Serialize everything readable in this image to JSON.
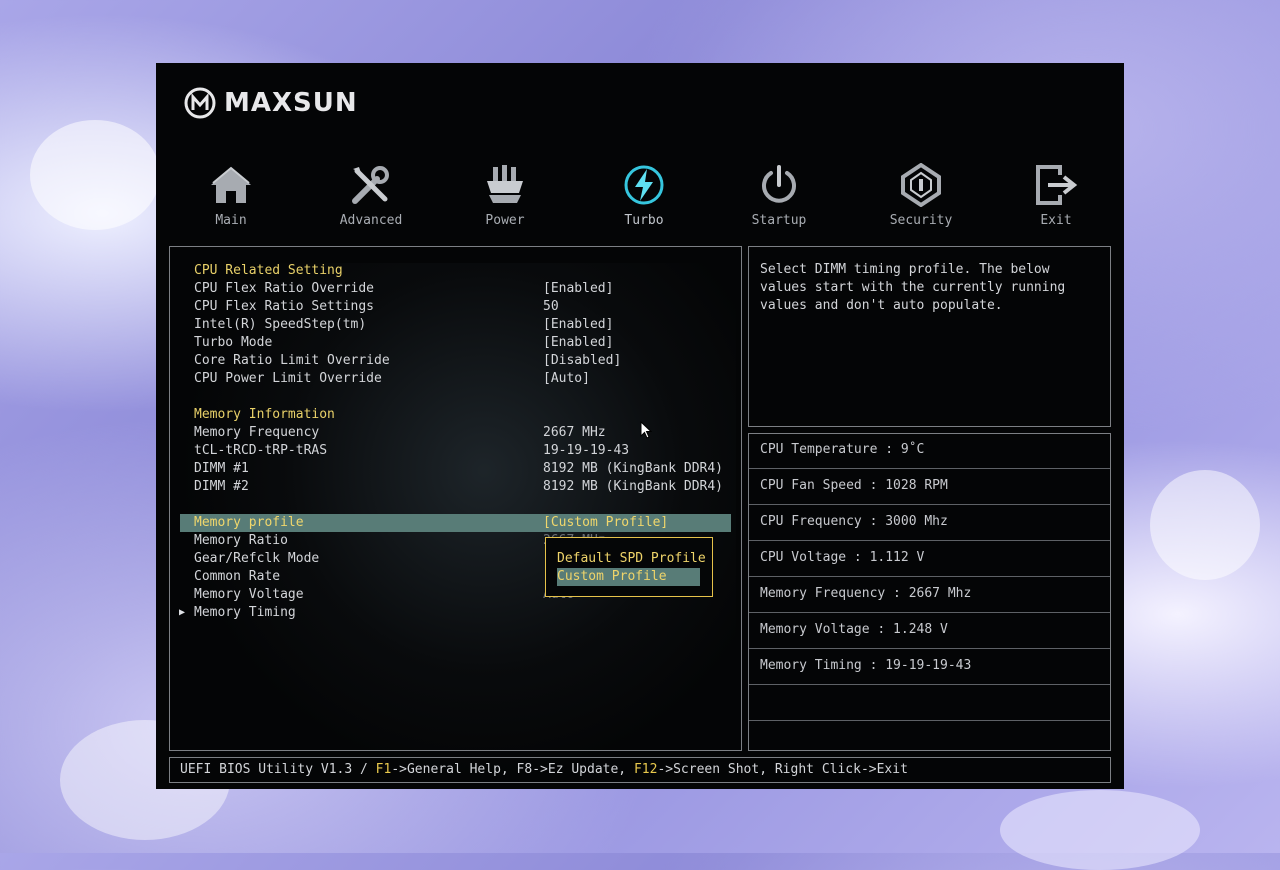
{
  "brand": {
    "name": "MAXSUN"
  },
  "nav": [
    {
      "label": "Main",
      "icon": "home-icon",
      "active": false
    },
    {
      "label": "Advanced",
      "icon": "tools-icon",
      "active": false
    },
    {
      "label": "Power",
      "icon": "chip-icon",
      "active": false
    },
    {
      "label": "Turbo",
      "icon": "lightning-icon",
      "active": true
    },
    {
      "label": "Startup",
      "icon": "power-icon",
      "active": false
    },
    {
      "label": "Security",
      "icon": "shield-icon",
      "active": false
    },
    {
      "label": "Exit",
      "icon": "exit-icon",
      "active": false
    }
  ],
  "settings": {
    "cpu_header": "CPU Related Setting",
    "cpu_flex_ratio_override": {
      "label": "CPU Flex Ratio Override",
      "value": "[Enabled]"
    },
    "cpu_flex_ratio_settings": {
      "label": "CPU Flex Ratio Settings",
      "value": "50"
    },
    "speedstep": {
      "label": "Intel(R) SpeedStep(tm)",
      "value": "[Enabled]"
    },
    "turbo_mode": {
      "label": "Turbo Mode",
      "value": "[Enabled]"
    },
    "core_ratio_limit": {
      "label": "Core Ratio Limit Override",
      "value": "[Disabled]"
    },
    "cpu_power_limit": {
      "label": "CPU Power Limit Override",
      "value": "[Auto]"
    },
    "mem_header": "Memory Information",
    "memory_frequency": {
      "label": "Memory Frequency",
      "value": "2667 MHz"
    },
    "timings": {
      "label": "tCL-tRCD-tRP-tRAS",
      "value": "19-19-19-43"
    },
    "dimm1": {
      "label": "DIMM #1",
      "value": "8192 MB (KingBank DDR4)"
    },
    "dimm2": {
      "label": "DIMM #2",
      "value": "8192 MB (KingBank DDR4)"
    },
    "memory_profile": {
      "label": "Memory profile",
      "value": "[Custom Profile]"
    },
    "memory_ratio": {
      "label": "Memory Ratio",
      "value": "2667 MHz"
    },
    "gear_mode": {
      "label": "Gear/Refclk Mode"
    },
    "common_rate": {
      "label": "Common Rate"
    },
    "memory_voltage": {
      "label": "Memory Voltage",
      "value": "Auto"
    },
    "memory_timing": {
      "label": "Memory Timing"
    }
  },
  "popup": {
    "options": [
      "Default SPD Profile",
      "Custom Profile"
    ],
    "selected": "Custom Profile"
  },
  "help": {
    "text": "Select DIMM timing profile. The below\nvalues start with the currently running\nvalues and don't auto populate."
  },
  "stats": [
    "CPU Temperature : 9˚C",
    "CPU Fan Speed : 1028 RPM",
    "CPU Frequency : 3000 Mhz",
    "CPU Voltage : 1.112 V",
    "Memory Frequency : 2667 Mhz",
    "Memory Voltage : 1.248 V",
    "Memory Timing : 19-19-19-43",
    "",
    ""
  ],
  "status": {
    "prefix": "UEFI BIOS Utility V1.3 / ",
    "f1_key": "F1",
    "f1_text": "->General Help, F8->Ez Update, ",
    "f12_key": "F12",
    "f12_text": "->Screen Shot, Right Click->Exit"
  },
  "colors": {
    "accent_yellow": "#e9d169",
    "highlight": "#587c77",
    "active_nav": "#36c6de",
    "nav_icon": "#a7abb1"
  }
}
